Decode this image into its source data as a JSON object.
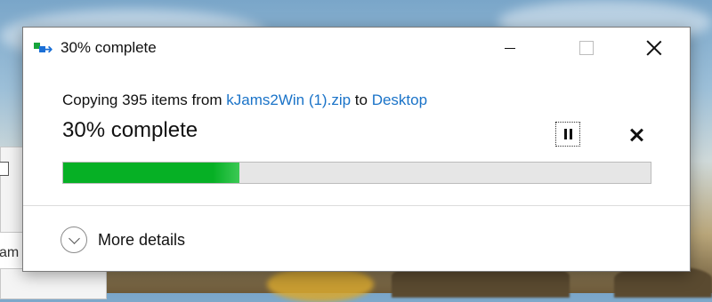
{
  "dialog": {
    "title": "30% complete",
    "copy_prefix": "Copying 395 items from ",
    "source": "kJams2Win (1).zip",
    "copy_middle": " to ",
    "destination": "Desktop",
    "status": "30% complete",
    "progress_percent": 30,
    "more_details_label": "More details"
  },
  "background_window": {
    "field_text": "am"
  },
  "colors": {
    "progress_fill": "#06b025",
    "link": "#1a73c8"
  },
  "icons": [
    "file-copy-icon",
    "minimize-icon",
    "maximize-icon",
    "close-icon",
    "pause-icon",
    "cancel-icon",
    "chevron-down-icon"
  ]
}
